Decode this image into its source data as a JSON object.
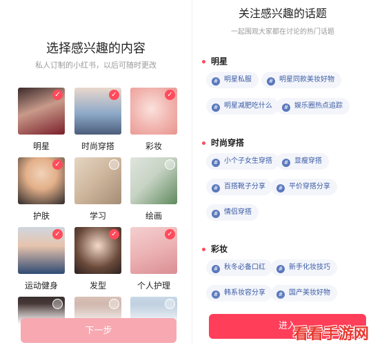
{
  "left": {
    "title": "选择感兴趣的内容",
    "subtitle": "私人订制的小红书，以后可随时更改",
    "categories": [
      {
        "label": "明星",
        "selected": true
      },
      {
        "label": "时尚穿搭",
        "selected": true
      },
      {
        "label": "彩妆",
        "selected": true
      },
      {
        "label": "护肤",
        "selected": true
      },
      {
        "label": "学习",
        "selected": false
      },
      {
        "label": "绘画",
        "selected": false
      },
      {
        "label": "运动健身",
        "selected": true
      },
      {
        "label": "发型",
        "selected": true
      },
      {
        "label": "个人护理",
        "selected": true
      },
      {
        "label": "",
        "selected": false
      },
      {
        "label": "",
        "selected": false
      },
      {
        "label": "",
        "selected": false
      }
    ],
    "next_label": "下一步"
  },
  "right": {
    "title": "关注感兴趣的话题",
    "subtitle": "一起围观大家都在讨论的热门话题",
    "sections": [
      {
        "title": "明星",
        "chips": [
          "明星私服",
          "明星同款美妆好物",
          "明星减肥吃什么",
          "娱乐圈热点追踪"
        ]
      },
      {
        "title": "时尚穿搭",
        "chips": [
          "小个子女生穿搭",
          "显瘦穿搭",
          "百搭靴子分享",
          "平价穿搭分享",
          "情侣穿搭"
        ]
      },
      {
        "title": "彩妆",
        "chips": [
          "秋冬必备口红",
          "新手化妆技巧",
          "韩系妆容分享",
          "国产美妆好物"
        ]
      }
    ],
    "enter_label": "进入"
  },
  "watermark": "看看手游网",
  "colors": {
    "accent": "#ff4b5c",
    "chip_text": "#3b5ba5",
    "chip_bg": "#f3f5fa",
    "next_button": "#f7a8b1"
  }
}
